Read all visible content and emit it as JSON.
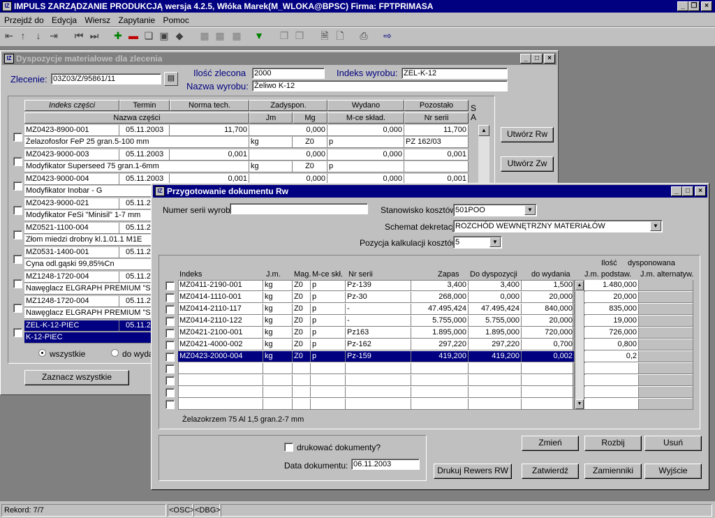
{
  "app": {
    "title": "IMPULS ZARZĄDZANIE PRODUKCJĄ wersja 4.2.5, Włóka Marek(M_WLOKA@BPSC) Firma: FPTPRIMASA",
    "menu": [
      "Przejdź do",
      "Edycja",
      "Wiersz",
      "Zapytanie",
      "Pomoc"
    ],
    "status": {
      "record": "Rekord: 7/7",
      "osc": "<OSC>",
      "dbg": "<DBG>"
    }
  },
  "disp": {
    "title": "Dyspozycje materiałowe dla zlecenia",
    "zlecenie_label": "Zlecenie:",
    "zlecenie_value": "03Z03/Z/95861/11",
    "ilosc_label": "Ilość zlecona",
    "ilosc_value": "2000",
    "indeks_label": "Indeks wyrobu:",
    "indeks_value": "ZEL-K-12",
    "nazwa_label": "Nazwa wyrobu:",
    "nazwa_value": "Żeliwo K-12",
    "headers_top": [
      "Indeks części",
      "Termin",
      "Norma tech.",
      "Zadyspon.",
      "Wydano",
      "Pozostało"
    ],
    "headers_bottom": [
      "Nazwa części",
      "Jm",
      "Mg",
      "M-ce skład.",
      "Nr serii"
    ],
    "sa": "S A",
    "rows": [
      {
        "indeks": "MZ0423-8900-001",
        "termin": "05.11.2003",
        "norma": "11,700",
        "zadysp": "0,000",
        "wydano": "0,000",
        "pozostalo": "11,700",
        "nazwa": "Żelazofosfor FeP 25 gran.5-100 mm",
        "jm": "kg",
        "mg": "Z0",
        "mce": "p",
        "nrserii": "PZ 162/03"
      },
      {
        "indeks": "MZ0423-9000-003",
        "termin": "05.11.2003",
        "norma": "0,001",
        "zadysp": "0,000",
        "wydano": "0,000",
        "pozostalo": "0,001",
        "nazwa": "Modyfikator Superseed 75 gran.1-6mm",
        "jm": "kg",
        "mg": "Z0",
        "mce": "p",
        "nrserii": ""
      },
      {
        "indeks": "MZ0423-9000-004",
        "termin": "05.11.2003",
        "norma": "0,001",
        "zadysp": "0,000",
        "wydano": "0,000",
        "pozostalo": "0,001",
        "nazwa": "Modyfikator Inobar - G",
        "jm": "",
        "mg": "",
        "mce": "",
        "nrserii": ""
      },
      {
        "indeks": "MZ0423-9000-021",
        "termin": "05.11.2",
        "norma": "",
        "zadysp": "",
        "wydano": "",
        "pozostalo": "",
        "nazwa": "Modyfikator FeSi \"Minisil\" 1-7 mm",
        "jm": "",
        "mg": "",
        "mce": "",
        "nrserii": ""
      },
      {
        "indeks": "MZ0521-1100-004",
        "termin": "05.11.2",
        "norma": "",
        "zadysp": "",
        "wydano": "",
        "pozostalo": "",
        "nazwa": "Złom miedzi drobny kl.1.01.1 M1E",
        "jm": "",
        "mg": "",
        "mce": "",
        "nrserii": ""
      },
      {
        "indeks": "MZ0531-1400-001",
        "termin": "05.11.2",
        "norma": "",
        "zadysp": "",
        "wydano": "",
        "pozostalo": "",
        "nazwa": "Cyna odl.gąski 99,85%Cn",
        "jm": "",
        "mg": "",
        "mce": "",
        "nrserii": ""
      },
      {
        "indeks": "MZ1248-1720-004",
        "termin": "05.11.2",
        "norma": "",
        "zadysp": "",
        "wydano": "",
        "pozostalo": "",
        "nazwa": "Nawęglacz ELGRAPH PREMIUM \"S\"",
        "jm": "",
        "mg": "",
        "mce": "",
        "nrserii": ""
      },
      {
        "indeks": "MZ1248-1720-004",
        "termin": "05.11.2",
        "norma": "",
        "zadysp": "",
        "wydano": "",
        "pozostalo": "",
        "nazwa": "Nawęglacz ELGRAPH PREMIUM \"S\"",
        "jm": "",
        "mg": "",
        "mce": "",
        "nrserii": ""
      },
      {
        "indeks": "ZEL-K-12-PIEC",
        "termin": "05.11.2",
        "norma": "",
        "zadysp": "",
        "wydano": "",
        "pozostalo": "",
        "nazwa": "K-12-PIEC",
        "jm": "",
        "mg": "",
        "mce": "",
        "nrserii": ""
      }
    ],
    "radio_all": "wszystkie",
    "radio_do": "do wyda",
    "btn_mark_all": "Zaznacz wszystkie",
    "btn_rw": "Utwórz Rw",
    "btn_zw": "Utwórz Zw"
  },
  "rw": {
    "title": "Przygotowanie dokumentu Rw",
    "numer_label": "Numer serii wyrobu",
    "numer_value": "",
    "stanowisko_label": "Stanowisko kosztów:",
    "stanowisko_value": "501POO",
    "schemat_label": "Schemat dekretacji:",
    "schemat_value": "ROZCHÓD WEWNĘTRZNY MATERIAŁÓW",
    "pozycja_label": "Pozycja kalkulacji kosztów:",
    "pozycja_value": "5",
    "headers": {
      "indeks": "Indeks",
      "jm": "J.m.",
      "mag": "Mag.",
      "mce": "M-ce skł.",
      "nrserii": "Nr serii",
      "zapas": "Zapas",
      "dodysp": "Do dyspozycji",
      "dowydania": "do wydania",
      "ilosc": "Ilość",
      "dysponowana": "dysponowana",
      "jmpodst": "J.m. podstaw.",
      "jmalt": "J.m. alternatyw."
    },
    "rows": [
      {
        "indeks": "MZ0411-2190-001",
        "jm": "kg",
        "mag": "Z0",
        "mce": "p",
        "nrserii": "Pz-139",
        "zapas": "3,400",
        "dodysp": "3,400",
        "dowydania": "1,500",
        "jmpodst": "1.480,000"
      },
      {
        "indeks": "MZ0414-1110-001",
        "jm": "kg",
        "mag": "Z0",
        "mce": "p",
        "nrserii": "Pz-30",
        "zapas": "268,000",
        "dodysp": "0,000",
        "dowydania": "20,000",
        "jmpodst": "20,000"
      },
      {
        "indeks": "MZ0414-2110-117",
        "jm": "kg",
        "mag": "Z0",
        "mce": "p",
        "nrserii": "-",
        "zapas": "47.495,424",
        "dodysp": "47.495,424",
        "dowydania": "840,000",
        "jmpodst": "835,000"
      },
      {
        "indeks": "MZ0414-2110-122",
        "jm": "kg",
        "mag": "Z0",
        "mce": "p",
        "nrserii": "-",
        "zapas": "5.755,000",
        "dodysp": "5.755,000",
        "dowydania": "20,000",
        "jmpodst": "19,000"
      },
      {
        "indeks": "MZ0421-2100-001",
        "jm": "kg",
        "mag": "Z0",
        "mce": "p",
        "nrserii": "Pz163",
        "zapas": "1.895,000",
        "dodysp": "1.895,000",
        "dowydania": "720,000",
        "jmpodst": "726,000"
      },
      {
        "indeks": "MZ0421-4000-002",
        "jm": "kg",
        "mag": "Z0",
        "mce": "p",
        "nrserii": "Pz-162",
        "zapas": "297,220",
        "dodysp": "297,220",
        "dowydania": "0,700",
        "jmpodst": "0,800"
      },
      {
        "indeks": "MZ0423-2000-004",
        "jm": "kg",
        "mag": "Z0",
        "mce": "p",
        "nrserii": "Pz-159",
        "zapas": "419,200",
        "dodysp": "419,200",
        "dowydania": "0,002",
        "jmpodst": "0,2"
      }
    ],
    "desc": "Żelazokrzem 75 Al 1,5 gran.2-7 mm",
    "print_label": "drukować dokumenty?",
    "data_label": "Data dokumentu:",
    "data_value": "06.11.2003",
    "btn_zmien": "Zmień",
    "btn_rozbij": "Rozbij",
    "btn_usun": "Usuń",
    "btn_drukuj": "Drukuj Rewers RW",
    "btn_zatwierdz": "Zatwierdź",
    "btn_zamienniki": "Zamienniki",
    "btn_wyjscie": "Wyjście"
  }
}
